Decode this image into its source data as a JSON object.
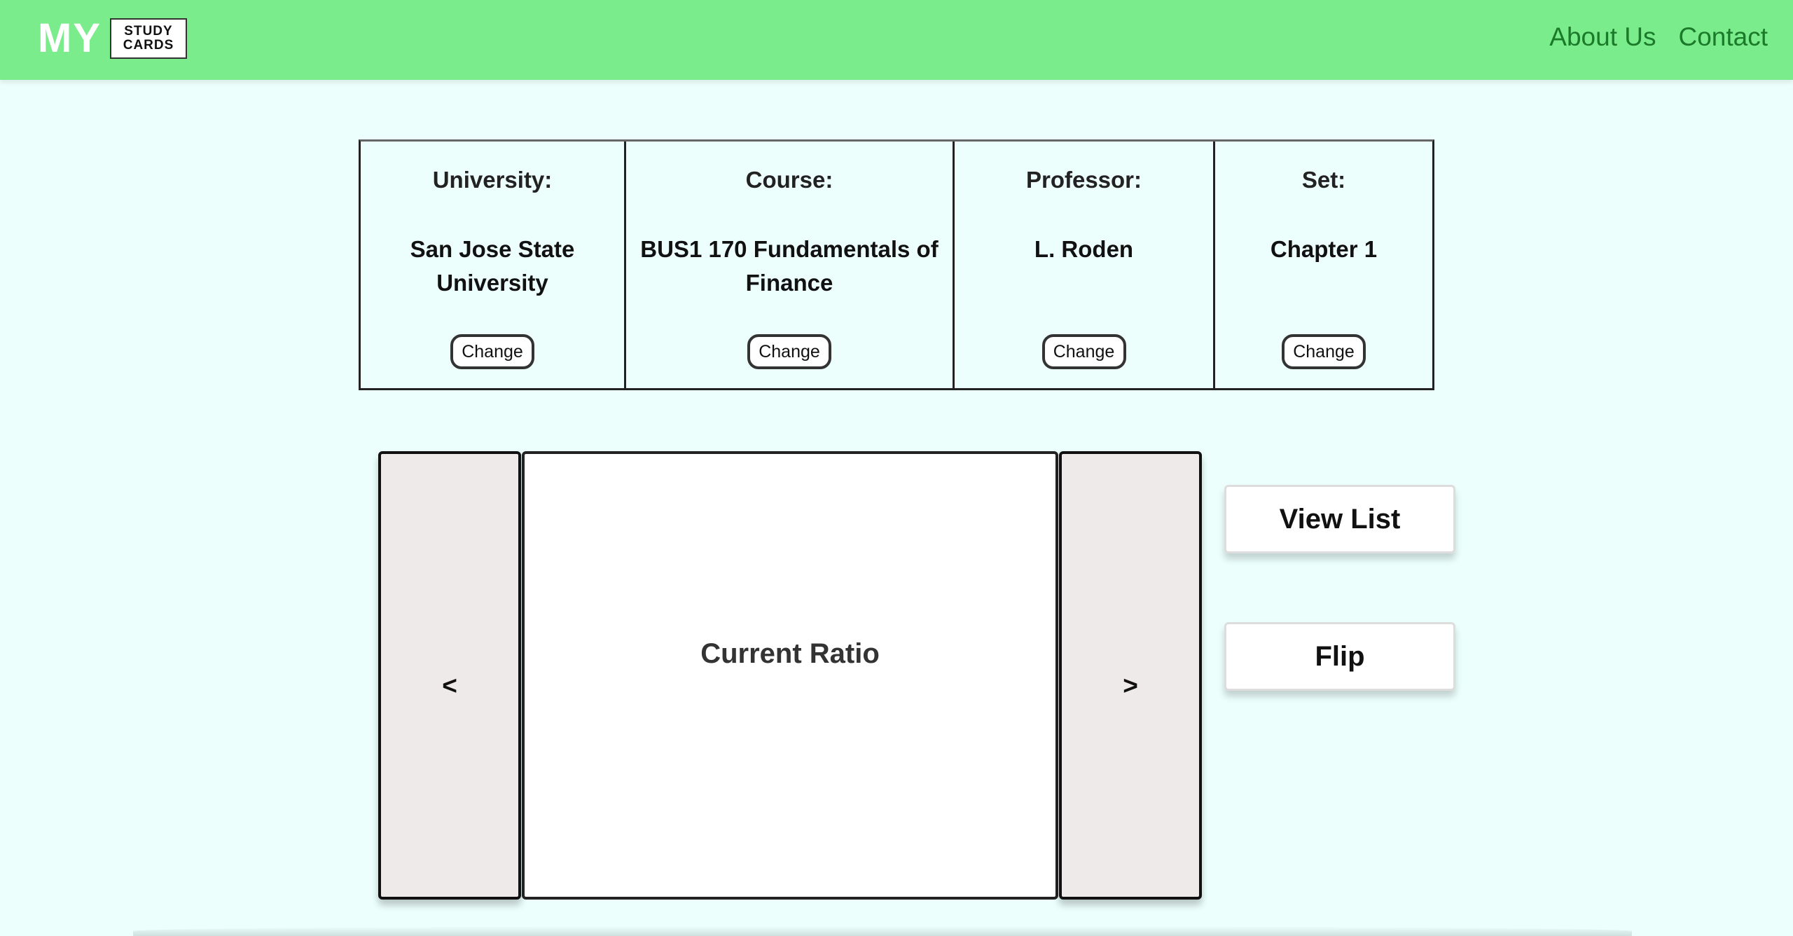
{
  "header": {
    "logo_main": "MY",
    "logo_line1": "STUDY",
    "logo_line2": "CARDS",
    "nav": [
      {
        "label": "About Us"
      },
      {
        "label": "Contact"
      }
    ]
  },
  "selection": {
    "change_label": "Change",
    "cells": [
      {
        "heading": "University:",
        "value": "San Jose State University"
      },
      {
        "heading": "Course:",
        "value": "BUS1 170 Fundamentals of Finance"
      },
      {
        "heading": "Professor:",
        "value": "L. Roden"
      },
      {
        "heading": "Set:",
        "value": "Chapter 1"
      }
    ]
  },
  "flashcard": {
    "prev_label": "<",
    "next_label": ">",
    "current_text": "Current Ratio"
  },
  "actions": {
    "view_list_label": "View List",
    "flip_label": "Flip"
  },
  "colors": {
    "header_bg": "#7bec8c",
    "page_bg": "#ecfffd",
    "nav_link": "#1a7a2a",
    "nav_button_bg": "#eeeaea"
  }
}
